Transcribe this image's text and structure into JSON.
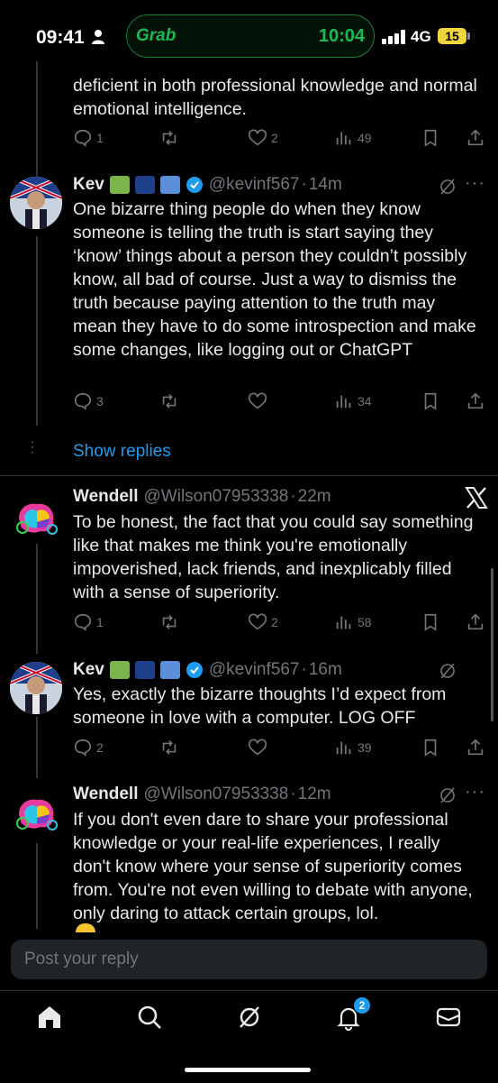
{
  "status_bar": {
    "time": "09:41",
    "pill_app": "Grab",
    "pill_time": "10:04",
    "network": "4G",
    "battery": "15"
  },
  "tweets": [
    {
      "id": "t0",
      "text": "deficient in both professional knowledge and normal emotional intelligence.",
      "replies": "1",
      "retweets": "",
      "likes": "2",
      "views": "49"
    },
    {
      "id": "t1",
      "name": "Kev",
      "handle": "@kevinf567",
      "time": "14m",
      "text": "One bizarre thing people do when they know someone is telling the truth is start saying they ‘know’ things about a person they couldn’t possibly know, all bad of course. Just a way to dismiss the truth because paying attention to the truth may mean they have to do some introspection and make some changes, like logging out or ChatGPT",
      "replies": "3",
      "retweets": "",
      "likes": "",
      "views": "34"
    },
    {
      "id": "t2",
      "name": "Wendell",
      "handle": "@Wilson07953338",
      "time": "22m",
      "text": "To be honest, the fact that you could say something like that makes me think you're emotionally impoverished, lack friends, and inexplicably filled with a sense of superiority.",
      "replies": "1",
      "retweets": "",
      "likes": "2",
      "views": "58"
    },
    {
      "id": "t3",
      "name": "Kev",
      "handle": "@kevinf567",
      "time": "16m",
      "text": "Yes, exactly the bizarre thoughts I’d expect from someone in love with a computer. LOG OFF",
      "replies": "2",
      "retweets": "",
      "likes": "",
      "views": "39"
    },
    {
      "id": "t4",
      "name": "Wendell",
      "handle": "@Wilson07953338",
      "time": "12m",
      "text": "If you don't even dare to share your professional knowledge or your real-life experiences, I really don't know where your sense of superiority comes from. You're not even willing to debate with anyone, only daring to attack certain groups, lol."
    }
  ],
  "show_replies": "Show replies",
  "reply_placeholder": "Post your reply",
  "tabbar": {
    "notification_count": "2",
    "icons": [
      "home-icon",
      "search-icon",
      "grok-icon",
      "bell-icon",
      "mail-icon"
    ]
  },
  "colors": {
    "accent": "#1d9bf0",
    "grab_green": "#1db954",
    "muted": "#71767b",
    "verified": "#1d9bf0"
  }
}
